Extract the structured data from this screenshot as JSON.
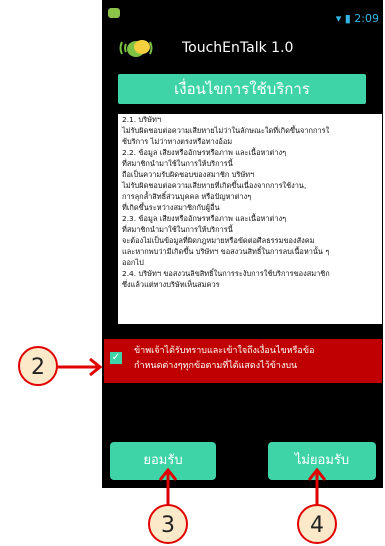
{
  "statusbar": {
    "time": "2:09"
  },
  "app": {
    "title": "TouchEnTalk 1.0"
  },
  "banner": {
    "title": "เงื่อนไขการใช้บริการ"
  },
  "terms": {
    "lines": [
      "2.1. บริษัทฯ",
      "ไม่รับผิดชอบต่อความเสียหายไม่ว่าในลักษณะใดที่เกิดขึ้นจากการใ",
      "ช้บริการ ไม่ว่าทางตรงหรือทางอ้อม",
      "2.2. ข้อมูล เสียงหรืออักษรหรือภาพ และเนื้อหาต่างๆ",
      "ที่สมาชิกนำมาใช้ในการให้บริการนี้",
      "ถือเป็นความรับผิดชอบของสมาชิก บริษัทฯ",
      "ไม่รับผิดชอบต่อความเสียหายที่เกิดขึ้นเนื่องจากการใช้งาน,",
      "การลุกล้ำสิทธิ์ส่วนบุคคล หรือปัญหาต่างๆ",
      "ที่เกิดขึ้นระหว่างสมาชิกกับผู้อื่น",
      "2.3. ข้อมูล เสียงหรืออักษรหรือภาพ และเนื้อหาต่างๆ",
      "ที่สมาชิกนำมาใช้ในการให้บริการนี้",
      "จะต้องไม่เป็นข้อมูลที่ผิดกฎหมายหรือขัดต่อศีลธรรมของสังคม",
      "และหากพบว่ามีเกิดขึ้น บริษัทฯ ขอสงวนสิทธิ์ในการลบเนื้อหานั้น ๆ",
      "ออกไป",
      "2.4. บริษัทฯ ขอสงวนลิขสิทธิ์ในการระงับการใช้บริการของสมาชิก",
      "ซึ่งแล้วแต่ทางบริษัทเห็นสมควร"
    ]
  },
  "agree": {
    "checked": true,
    "line1": "ข้าพเจ้าได้รับทราบและเข้าใจถึงเงื่อนไขหรือข้อ",
    "line2": "กำหนดต่างๆทุกข้อตามที่ได้แสดงไว้ข้างบน"
  },
  "buttons": {
    "accept": "ยอมรับ",
    "decline": "ไม่ยอมรับ"
  },
  "callouts": {
    "agree": "2",
    "accept": "3",
    "decline": "4"
  },
  "colors": {
    "accent": "#3fd4a8",
    "highlight": "#c00000",
    "callout_border": "#e00000",
    "callout_fill": "#fbe9c9"
  }
}
